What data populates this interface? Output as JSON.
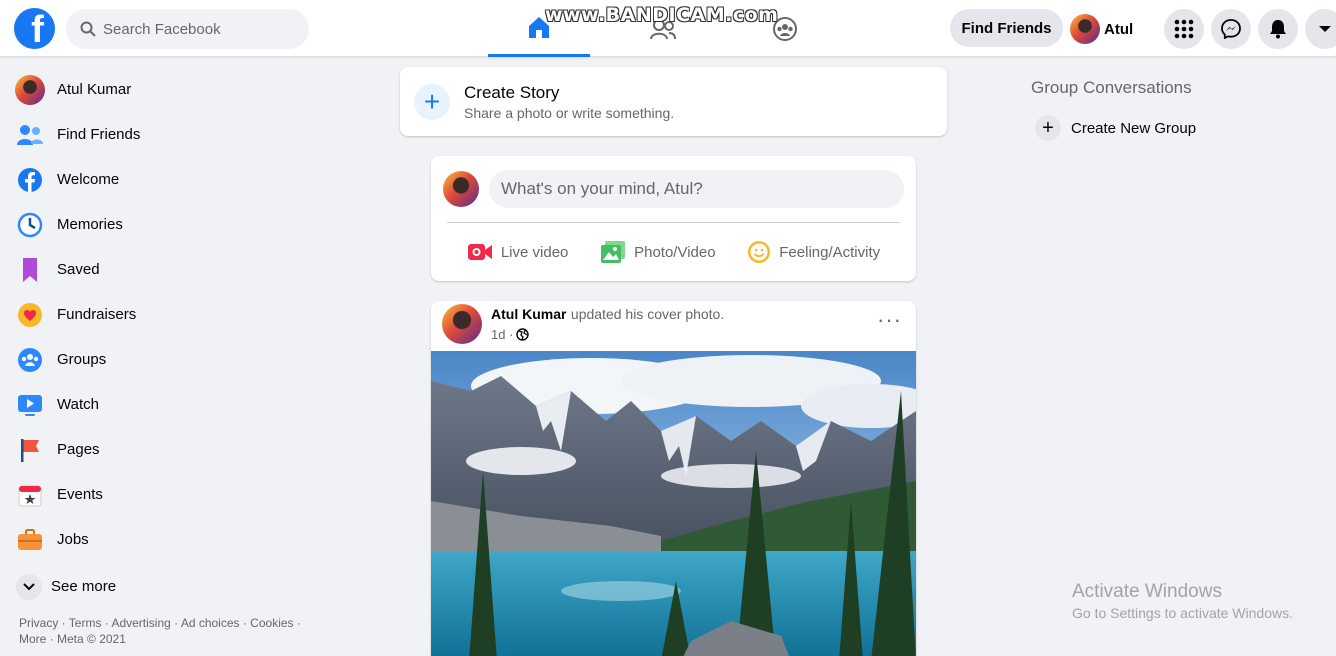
{
  "topbar": {
    "logo": "f",
    "search_placeholder": "Search Facebook",
    "watermark": "www.BANDICAM.com",
    "find_friends": "Find Friends",
    "profile_name": "Atul",
    "icons": [
      "home-icon",
      "friends-icon",
      "groups-icon",
      "menu-grid-icon",
      "messenger-icon",
      "notifications-icon",
      "account-dropdown-icon"
    ]
  },
  "sidebar": {
    "items": [
      {
        "label": "Atul Kumar",
        "icon": "avatar"
      },
      {
        "label": "Find Friends",
        "icon": "friends-icon"
      },
      {
        "label": "Welcome",
        "icon": "facebook-icon"
      },
      {
        "label": "Memories",
        "icon": "clock-icon"
      },
      {
        "label": "Saved",
        "icon": "bookmark-icon"
      },
      {
        "label": "Fundraisers",
        "icon": "heart-icon"
      },
      {
        "label": "Groups",
        "icon": "groups-icon"
      },
      {
        "label": "Watch",
        "icon": "watch-icon"
      },
      {
        "label": "Pages",
        "icon": "flag-icon"
      },
      {
        "label": "Events",
        "icon": "calendar-icon"
      },
      {
        "label": "Jobs",
        "icon": "briefcase-icon"
      }
    ],
    "see_more": "See more",
    "footer_line1": "Privacy · Terms · Advertising · Ad choices · Cookies ·",
    "footer_line2": "More · Meta © 2021"
  },
  "story": {
    "title": "Create Story",
    "subtitle": "Share a photo or write something."
  },
  "composer": {
    "placeholder": "What's on your mind, Atul?",
    "actions": [
      "Live video",
      "Photo/Video",
      "Feeling/Activity"
    ]
  },
  "post": {
    "author": "Atul Kumar",
    "action": "updated his cover photo.",
    "time": "1d ·",
    "more": "···"
  },
  "right": {
    "title": "Group Conversations",
    "create_group": "Create New Group"
  },
  "os_watermark": {
    "title": "Activate Windows",
    "subtitle": "Go to Settings to activate Windows."
  },
  "colors": {
    "brand": "#1877f2",
    "background": "#f0f2f5",
    "live": "#f02849",
    "photo": "#45bd62",
    "feeling": "#f7b928"
  }
}
